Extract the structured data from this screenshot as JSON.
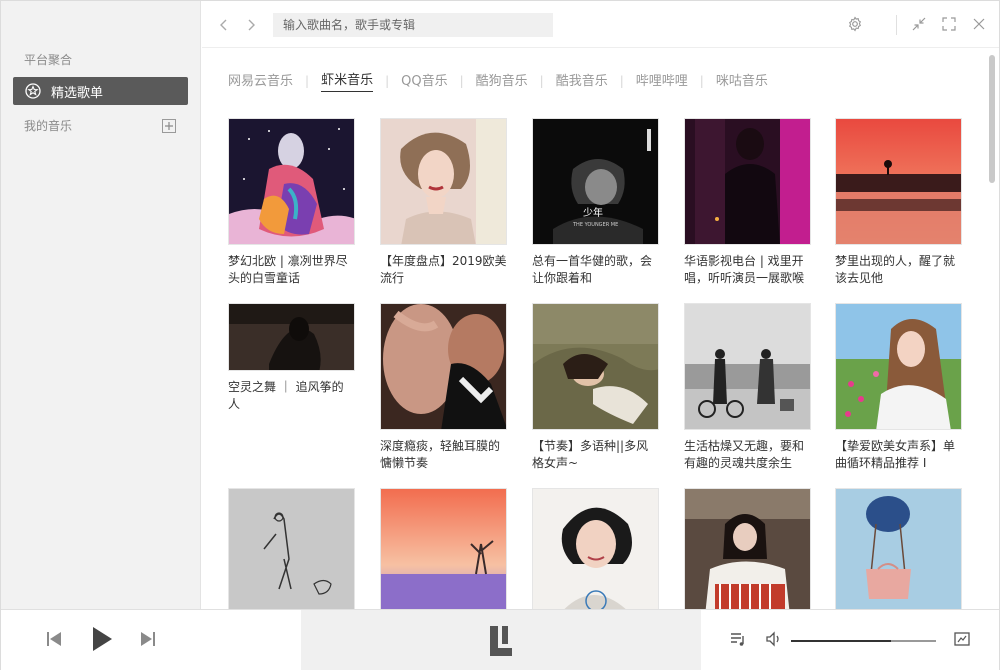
{
  "sidebar": {
    "section_label": "平台聚合",
    "active_item": "精选歌单",
    "my_music_label": "我的音乐"
  },
  "header": {
    "search_placeholder": "输入歌曲名，歌手或专辑"
  },
  "tabs": [
    {
      "label": "网易云音乐",
      "active": false
    },
    {
      "label": "虾米音乐",
      "active": true
    },
    {
      "label": "QQ音乐",
      "active": false
    },
    {
      "label": "酷狗音乐",
      "active": false
    },
    {
      "label": "酷我音乐",
      "active": false
    },
    {
      "label": "哔哩哔哩",
      "active": false
    },
    {
      "label": "咪咕音乐",
      "active": false
    }
  ],
  "playlists": [
    {
      "title": "梦幻北欧 | 凛冽世界尽头的白雪童话"
    },
    {
      "title": "【年度盘点】2019欧美流行"
    },
    {
      "title": "总有一首华健的歌，会让你跟着和"
    },
    {
      "title": "华语影视电台 | 戏里开唱，听听演员一展歌喉"
    },
    {
      "title": "梦里出现的人，醒了就该去见他"
    },
    {
      "title": "空灵之舞 ｜ 追风筝的人"
    },
    {
      "title": "深度瘾痰，轻触耳膜的慵懒节奏"
    },
    {
      "title": "【节奏】多语种||多风格女声~"
    },
    {
      "title": "生活枯燥又无趣，要和有趣的灵魂共度余生"
    },
    {
      "title": "【挚爱欧美女声系】单曲循环精品推荐 I"
    },
    {
      "title": ""
    },
    {
      "title": ""
    },
    {
      "title": ""
    },
    {
      "title": ""
    },
    {
      "title": ""
    }
  ],
  "cover_texts": {
    "album3_title": "少年",
    "album3_subtitle": "THE YOUNGER ME"
  },
  "colors": {
    "active_bg": "#5a5a5a",
    "sidebar_bg": "#f2f2f2",
    "player_mid_bg": "#f0f0f0"
  }
}
